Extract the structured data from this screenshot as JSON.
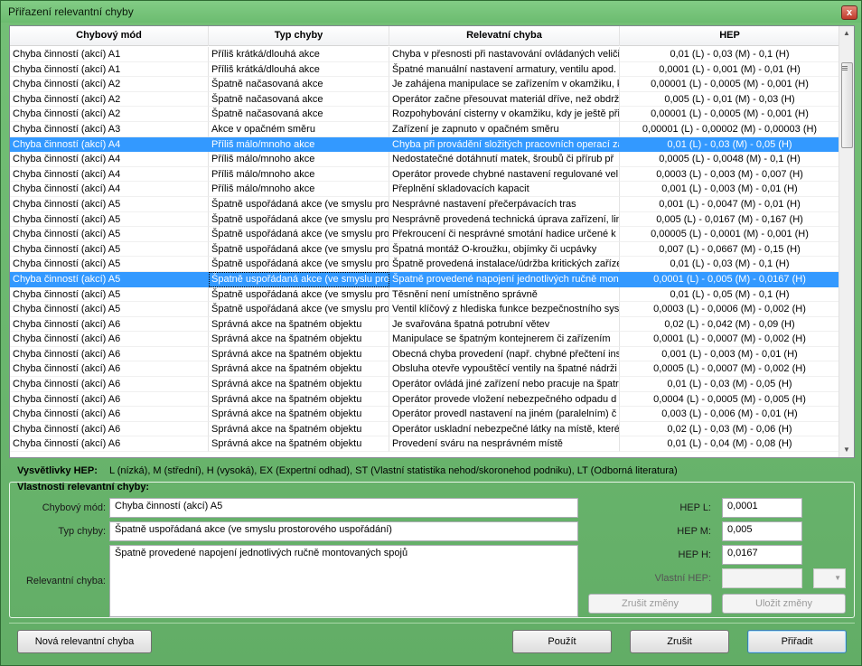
{
  "window": {
    "title": "Přiřazení relevantní chyby",
    "close_glyph": "x"
  },
  "grid": {
    "columns": [
      "Chybový mód",
      "Typ chyby",
      "Relevatní chyba",
      "HEP"
    ],
    "rows": [
      [
        "Chyba činností (akcí) A1",
        "Příliš krátká/dlouhá akce",
        "Chyba v přesnosti při nastavování ovládaných veliči",
        "0,01 (L) - 0,03 (M) - 0,1 (H)"
      ],
      [
        "Chyba činností (akcí) A1",
        "Příliš krátká/dlouhá akce",
        "Špatné manuální nastavení armatury, ventilu apod.",
        "0,0001 (L) - 0,001 (M) - 0,01 (H)"
      ],
      [
        "Chyba činností (akcí) A2",
        "Špatně načasovaná akce",
        "Je zahájena manipulace se zařízením v okamžiku, kc",
        "0,00001 (L) - 0,0005 (M) - 0,001 (H)"
      ],
      [
        "Chyba činností (akcí) A2",
        "Špatně načasovaná akce",
        "Operátor začne přesouvat materiál dříve, než obdrž",
        "0,005 (L) - 0,01 (M) - 0,03 (H)"
      ],
      [
        "Chyba činností (akcí) A2",
        "Špatně načasovaná akce",
        "Rozpohybování cisterny v okamžiku, kdy je ještě při",
        "0,00001 (L) - 0,0005 (M) - 0,001 (H)"
      ],
      [
        "Chyba činností (akcí) A3",
        "Akce v opačném směru",
        "Zařízení je zapnuto v opačném směru",
        "0,00001 (L) - 0,00002 (M) - 0,00003 (H)"
      ],
      [
        "Chyba činností (akcí) A4",
        "Příliš málo/mnoho akce",
        "Chyba při provádění složitých pracovních operací za",
        "0,01 (L) - 0,03 (M) - 0,05 (H)"
      ],
      [
        "Chyba činností (akcí) A4",
        "Příliš málo/mnoho akce",
        "Nedostatečné dotáhnutí matek, šroubů či přírub př",
        "0,0005 (L) - 0,0048 (M) - 0,1 (H)"
      ],
      [
        "Chyba činností (akcí) A4",
        "Příliš málo/mnoho akce",
        "Operátor provede chybné nastavení regulované vel",
        "0,0003 (L) - 0,003 (M) - 0,007 (H)"
      ],
      [
        "Chyba činností (akcí) A4",
        "Příliš málo/mnoho akce",
        "Přeplnění skladovacích kapacit",
        "0,001 (L) - 0,003 (M) - 0,01 (H)"
      ],
      [
        "Chyba činností (akcí) A5",
        "Špatně uspořádaná akce (ve smyslu pros",
        "Nesprávné nastavení přečerpávacích tras",
        "0,001 (L) - 0,0047 (M) - 0,01 (H)"
      ],
      [
        "Chyba činností (akcí) A5",
        "Špatně uspořádaná akce (ve smyslu pros",
        "Nesprávně provedená technická úprava zařízení, lin",
        "0,005 (L) - 0,0167 (M) - 0,167 (H)"
      ],
      [
        "Chyba činností (akcí) A5",
        "Špatně uspořádaná akce (ve smyslu pros",
        "Překroucení či nesprávné smotání hadice určené k p",
        "0,00005 (L) - 0,0001 (M) - 0,001 (H)"
      ],
      [
        "Chyba činností (akcí) A5",
        "Špatně uspořádaná akce (ve smyslu pros",
        "Špatná montáž O-kroužku, objímky či ucpávky",
        "0,007 (L) - 0,0667 (M) - 0,15 (H)"
      ],
      [
        "Chyba činností (akcí) A5",
        "Špatně uspořádaná akce (ve smyslu pros",
        "Špatně provedená instalace/údržba kritických zaříze",
        "0,01 (L) - 0,03 (M) - 0,1 (H)"
      ],
      [
        "Chyba činností (akcí) A5",
        "Špatně uspořádaná akce (ve smyslu pros",
        "Špatně provedené napojení jednotlivých ručně mon",
        "0,0001 (L) - 0,005 (M) - 0,0167 (H)"
      ],
      [
        "Chyba činností (akcí) A5",
        "Špatně uspořádaná akce (ve smyslu pros",
        "Těsnění není umístněno správně",
        "0,01 (L) - 0,05 (M) - 0,1 (H)"
      ],
      [
        "Chyba činností (akcí) A5",
        "Špatně uspořádaná akce (ve smyslu pros",
        "Ventil klíčový z hlediska funkce bezpečnostního syst",
        "0,0003 (L) - 0,0006 (M) - 0,002 (H)"
      ],
      [
        "Chyba činností (akcí) A6",
        "Správná akce na špatném objektu",
        "Je svařována špatná potrubní větev",
        "0,02 (L) - 0,042 (M) - 0,09 (H)"
      ],
      [
        "Chyba činností (akcí) A6",
        "Správná akce na špatném objektu",
        "Manipulace se špatným kontejnerem či zařízením",
        "0,0001 (L) - 0,0007 (M) - 0,002 (H)"
      ],
      [
        "Chyba činností (akcí) A6",
        "Správná akce na špatném objektu",
        "Obecná chyba provedení (např. chybné přečtení ins",
        "0,001 (L) - 0,003 (M) - 0,01 (H)"
      ],
      [
        "Chyba činností (akcí) A6",
        "Správná akce na špatném objektu",
        "Obsluha otevře vypouštěcí ventily na špatné nádrži",
        "0,0005 (L) - 0,0007 (M) - 0,002 (H)"
      ],
      [
        "Chyba činností (akcí) A6",
        "Správná akce na špatném objektu",
        "Operátor ovládá jiné zařízení nebo pracuje na špatr",
        "0,01 (L) - 0,03 (M) - 0,05 (H)"
      ],
      [
        "Chyba činností (akcí) A6",
        "Správná akce na špatném objektu",
        "Operátor provede vložení nebezpečného odpadu d",
        "0,0004 (L) - 0,0005 (M) - 0,005 (H)"
      ],
      [
        "Chyba činností (akcí) A6",
        "Správná akce na špatném objektu",
        "Operátor provedl nastavení na jiném (paralelním) č",
        "0,003 (L) - 0,006 (M) - 0,01 (H)"
      ],
      [
        "Chyba činností (akcí) A6",
        "Správná akce na špatném objektu",
        "Operátor uskladní nebezpečné látky na místě, které",
        "0,02 (L) - 0,03 (M) - 0,06 (H)"
      ],
      [
        "Chyba činností (akcí) A6",
        "Správná akce na špatném objektu",
        "Provedení sváru na nesprávném místě",
        "0,01 (L) - 0,04 (M) - 0,08 (H)"
      ]
    ],
    "selected_rows": [
      6,
      15
    ],
    "focused_row": 15
  },
  "legend": {
    "label": "Vysvětlivky HEP:",
    "text": "L (nízká), M (střední), H (vysoká), EX (Expertní odhad), ST (Vlastní statistika nehod/skoronehod podniku), LT (Odborná literatura)"
  },
  "properties": {
    "title": "Vlastnosti relevantní chyby:",
    "mode_label": "Chybový mód:",
    "mode_value": "Chyba činností (akcí) A5",
    "type_label": "Typ chyby:",
    "type_value": "Špatně uspořádaná akce (ve smyslu prostorového uspořádání)",
    "error_label": "Relevantní chyba:",
    "error_value": "Špatně provedené napojení jednotlivých ručně montovaných spojů",
    "hep_l_label": "HEP L:",
    "hep_l_value": "0,0001",
    "hep_m_label": "HEP M:",
    "hep_m_value": "0,005",
    "hep_h_label": "HEP H:",
    "hep_h_value": "0,0167",
    "own_hep_label": "Vlastní HEP:",
    "own_hep_value": "",
    "cancel_changes_label": "Zrušit změny",
    "save_changes_label": "Uložit změny"
  },
  "footer": {
    "new_label": "Nová relevantní chyba",
    "apply_label": "Použít",
    "cancel_label": "Zrušit",
    "assign_label": "Přiřadit"
  }
}
